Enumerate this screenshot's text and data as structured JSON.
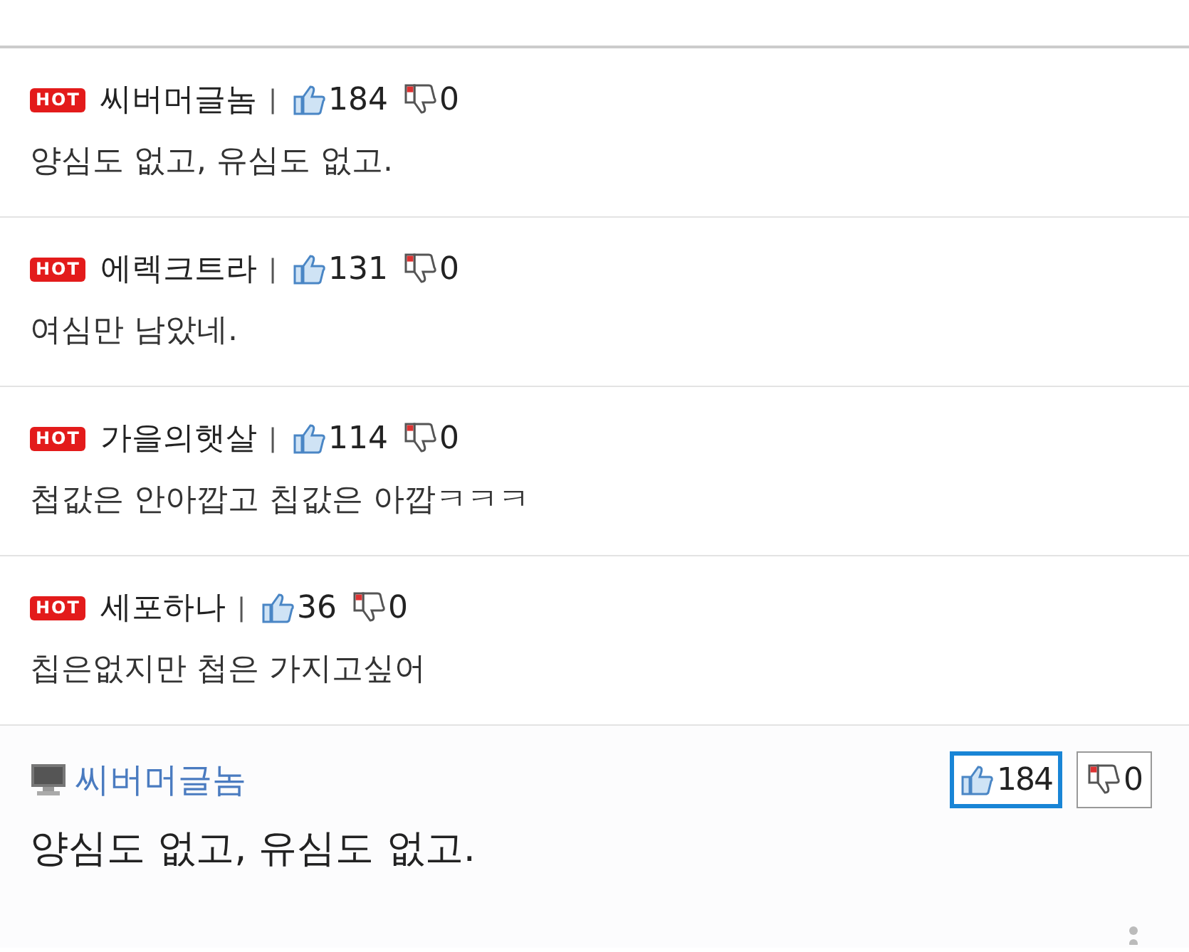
{
  "hot_comments": [
    {
      "badge": "HOT",
      "author": "씨버머글놈",
      "separator": "|",
      "likes": "184",
      "dislikes": "0",
      "text": "양심도 없고, 유심도 없고."
    },
    {
      "badge": "HOT",
      "author": "에렉크트라",
      "separator": "|",
      "likes": "131",
      "dislikes": "0",
      "text": "여심만 남았네."
    },
    {
      "badge": "HOT",
      "author": "가을의햇살",
      "separator": "|",
      "likes": "114",
      "dislikes": "0",
      "text": "첩값은 안아깝고 칩값은 아깝ㅋㅋㅋ"
    },
    {
      "badge": "HOT",
      "author": "세포하나",
      "separator": "|",
      "likes": "36",
      "dislikes": "0",
      "text": "칩은없지만 첩은 가지고싶어"
    }
  ],
  "comment": {
    "author": "씨버머글놈",
    "text": "양심도 없고, 유심도 없고.",
    "votes": [
      {
        "kind": "like",
        "count": "184",
        "selected": true
      },
      {
        "kind": "dislike",
        "count": "0",
        "selected": false
      }
    ]
  }
}
